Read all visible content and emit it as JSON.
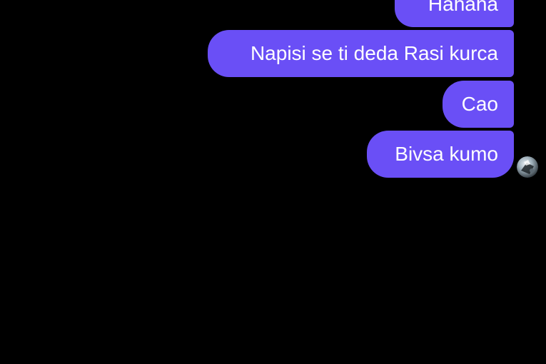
{
  "messages": [
    {
      "text": "Hahaha"
    },
    {
      "text": "Napisi se ti deda Rasi kurca"
    },
    {
      "text": "Cao"
    },
    {
      "text": "Bivsa kumo"
    }
  ],
  "colors": {
    "background": "#000000",
    "bubble": "#6a4ff6",
    "text": "#ffffff"
  },
  "icons": {
    "seen_indicator": "seen-avatar-icon"
  }
}
